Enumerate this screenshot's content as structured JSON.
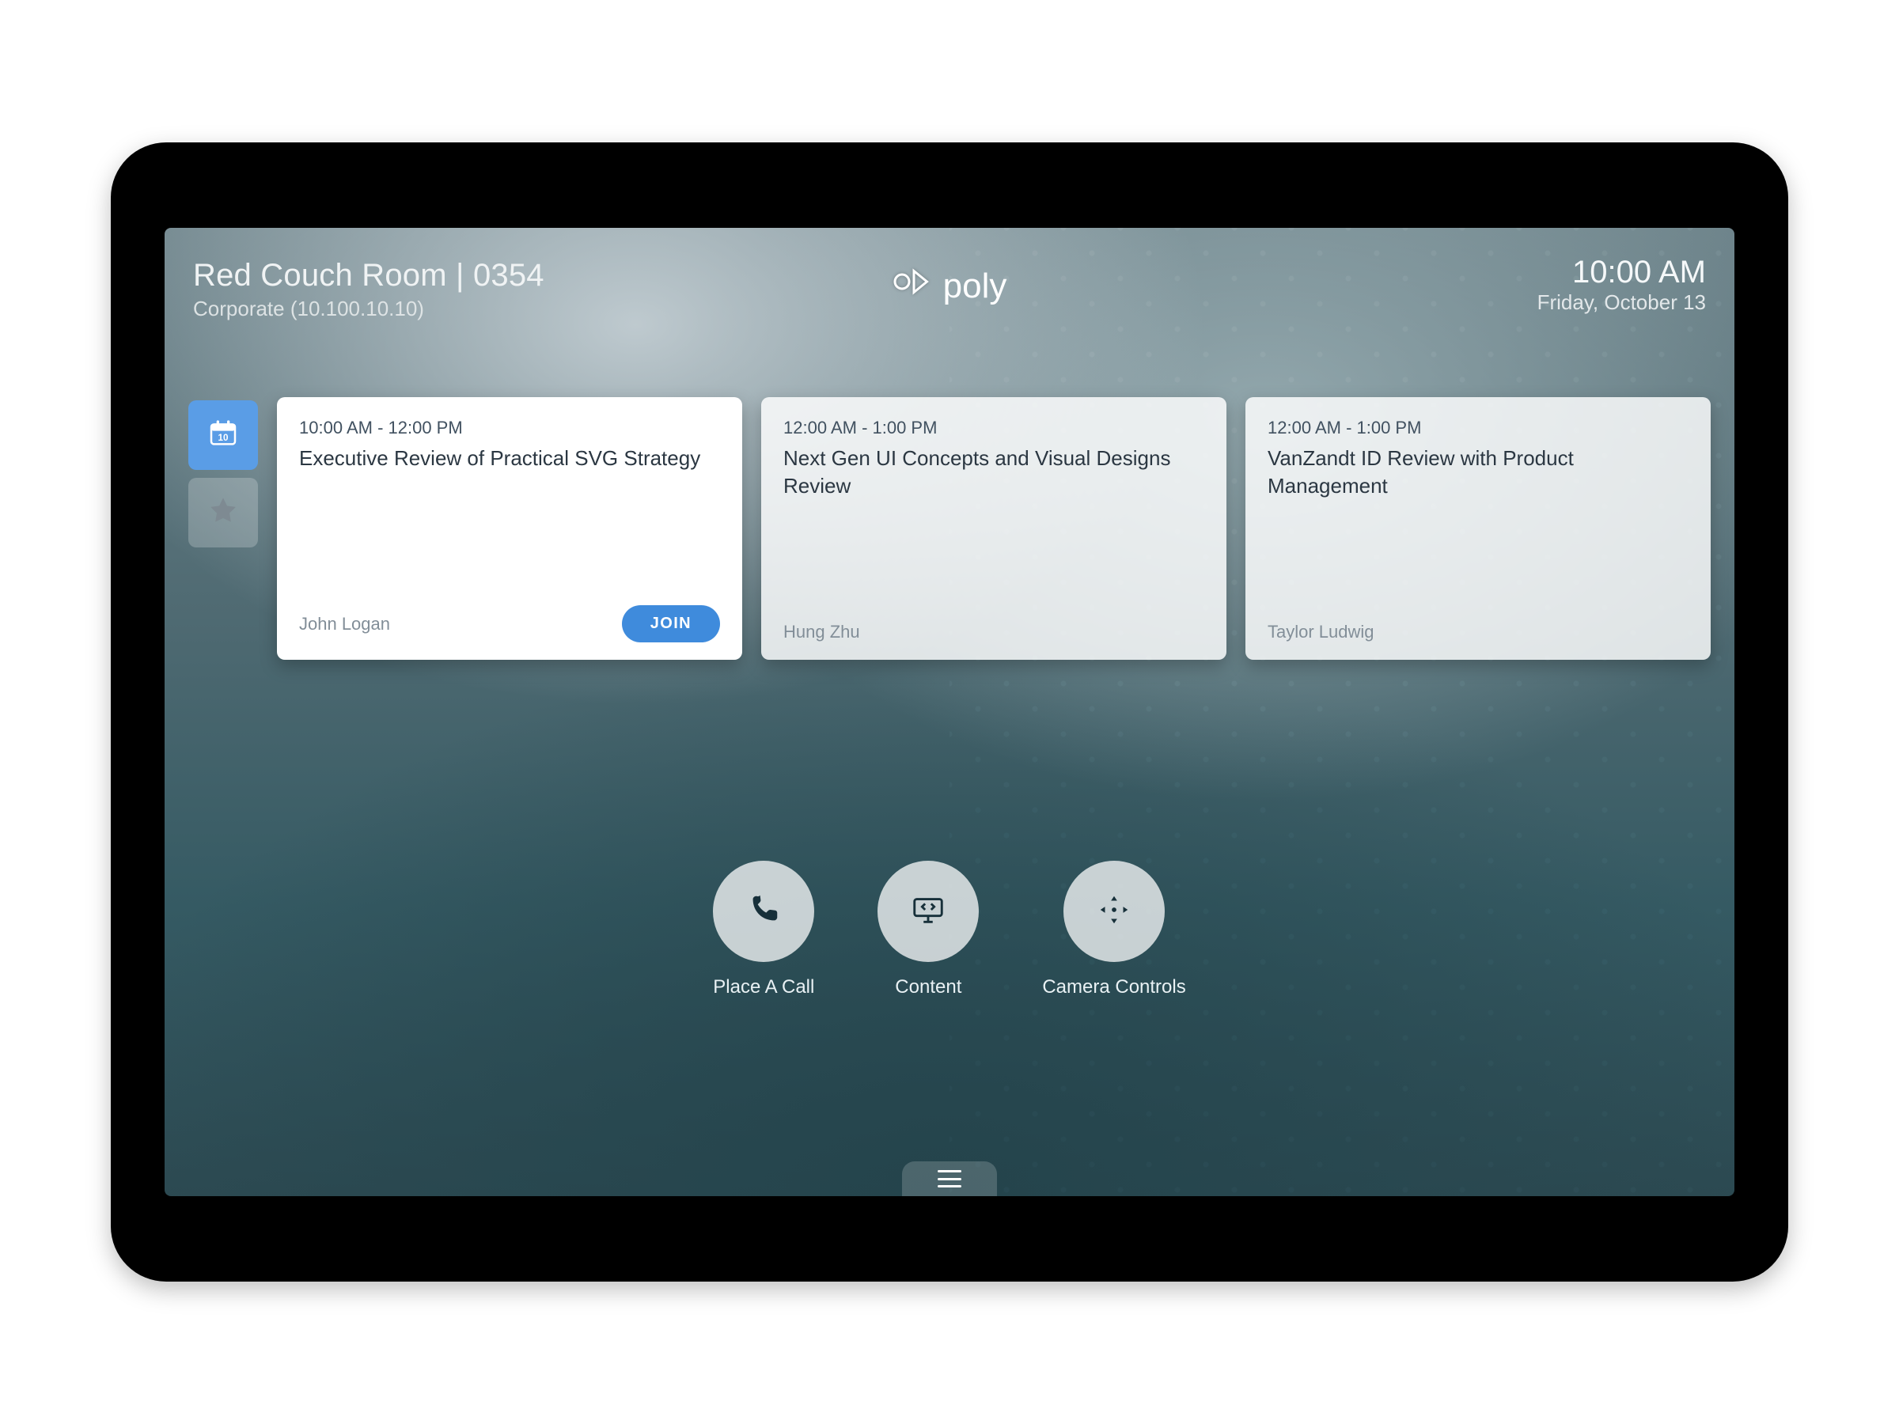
{
  "header": {
    "room_name": "Red Couch Room | 0354",
    "room_subtitle": "Corporate (10.100.10.10)",
    "brand": "poly",
    "time": "10:00 AM",
    "date": "Friday, October 13"
  },
  "sidebar": {
    "calendar_day": "10"
  },
  "meetings": [
    {
      "time": "10:00 AM - 12:00 PM",
      "title": "Executive Review of Practical SVG Strategy",
      "organizer": "John Logan",
      "join_label": "JOIN",
      "joinable": true
    },
    {
      "time": "12:00 AM - 1:00 PM",
      "title": "Next Gen UI Concepts and Visual Designs Review",
      "organizer": "Hung Zhu",
      "joinable": false
    },
    {
      "time": "12:00 AM - 1:00 PM",
      "title": "VanZandt ID Review with Product Management",
      "organizer": "Taylor Ludwig",
      "joinable": false
    }
  ],
  "actions": {
    "place_call": "Place A Call",
    "content": "Content",
    "camera_controls": "Camera Controls"
  }
}
